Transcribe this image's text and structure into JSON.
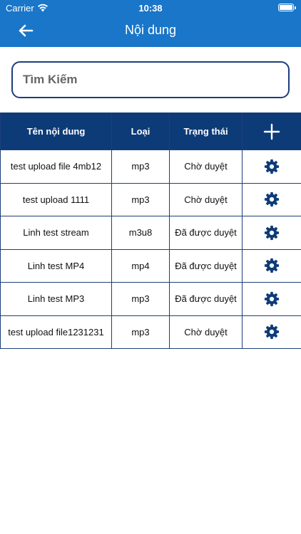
{
  "status_bar": {
    "carrier": "Carrier",
    "time": "10:38"
  },
  "header": {
    "title": "Nội dung"
  },
  "search": {
    "placeholder": "Tìm Kiếm"
  },
  "table": {
    "headers": {
      "name": "Tên nội dung",
      "type": "Loại",
      "status": "Trạng thái"
    },
    "rows": [
      {
        "name": "test upload file 4mb12",
        "type": "mp3",
        "status": "Chờ duyệt"
      },
      {
        "name": "test upload 1111",
        "type": "mp3",
        "status": "Chờ duyệt"
      },
      {
        "name": "Linh test stream",
        "type": "m3u8",
        "status": "Đã được duyệt"
      },
      {
        "name": "Linh test MP4",
        "type": "mp4",
        "status": "Đã được duyệt"
      },
      {
        "name": "Linh test MP3",
        "type": "mp3",
        "status": "Đã được duyệt"
      },
      {
        "name": "test upload file1231231",
        "type": "mp3",
        "status": "Chờ duyệt"
      }
    ]
  },
  "colors": {
    "header_bg": "#1976c9",
    "table_header_bg": "#0d3b78",
    "border": "#1b3f7a"
  },
  "icons": {
    "back": "arrow-left-icon",
    "add": "plus-icon",
    "row_action": "gear-icon"
  }
}
